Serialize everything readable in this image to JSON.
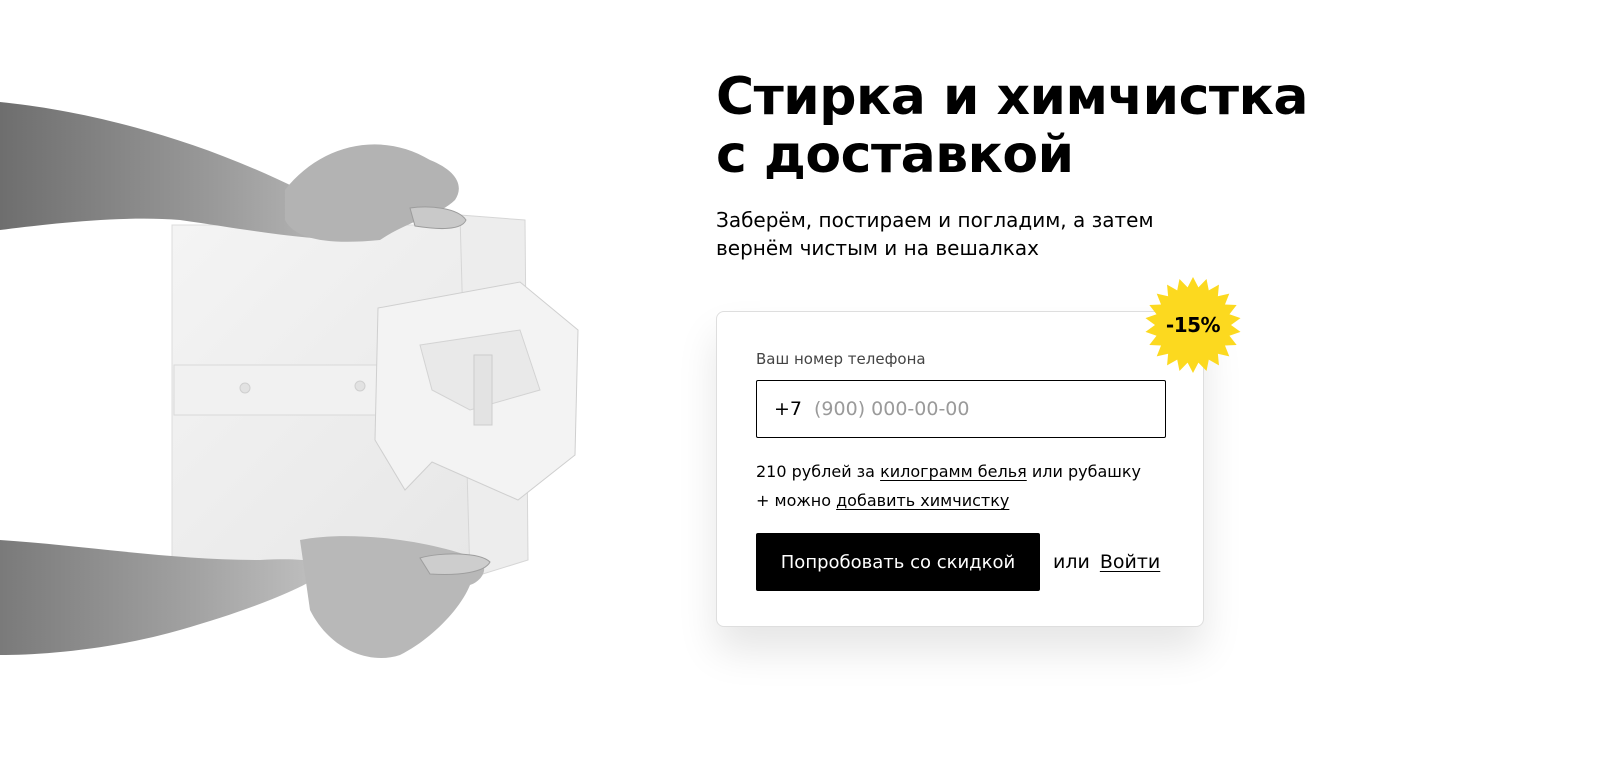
{
  "hero": {
    "title": "Стирка и химчистка\nс доставкой",
    "subtitle": "Заберём, постираем и погладим, а затем\nвернём чистым и на вешалках"
  },
  "badge": {
    "text": "-15%",
    "color": "#fcd91f"
  },
  "form": {
    "phone_label": "Ваш номер телефона",
    "phone_prefix": "+7",
    "phone_placeholder": "(900) 000-00-00",
    "phone_value": "",
    "price_line1": {
      "before": "210 рублей за ",
      "link": "килограмм белья",
      "after": " или рубашку"
    },
    "price_line2": {
      "before": "+ можно ",
      "link": "добавить химчистку"
    },
    "cta_label": "Попробовать со скидкой",
    "or_text": "или",
    "login_label": "Войти"
  },
  "illustration": {
    "icon": "folded-shirt-hands-photo"
  }
}
